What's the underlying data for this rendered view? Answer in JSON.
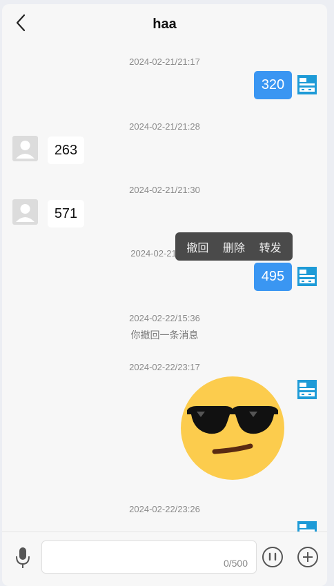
{
  "header": {
    "title": "haa"
  },
  "messages": [
    {
      "time": "2024-02-21/21:17",
      "from": "me",
      "text": "320"
    },
    {
      "time": "2024-02-21/21:28",
      "from": "other",
      "text": "263"
    },
    {
      "time": "2024-02-21/21:30",
      "from": "other",
      "text": "571"
    },
    {
      "time": "2024-02-21",
      "from": "me",
      "text": "495"
    },
    {
      "time": "2024-02-22/15:36",
      "notice": "你撤回一条消息"
    },
    {
      "time": "2024-02-22/23:17",
      "from": "me",
      "sticker": "sunglasses-emoji"
    },
    {
      "time": "2024-02-22/23:26",
      "from": "me"
    }
  ],
  "context_menu": {
    "recall": "撤回",
    "delete": "删除",
    "forward": "转发"
  },
  "input": {
    "counter": "0/500"
  },
  "icons": {
    "back": "chevron-left-icon",
    "mic": "microphone-icon",
    "emoji": "emoji-face-icon",
    "plus": "plus-circle-icon",
    "avatar_me": "pixel-avatar-icon",
    "avatar_other": "default-user-icon"
  },
  "colors": {
    "my_bubble": "#3a96f2",
    "my_avatar": "#1e9bd7",
    "menu_bg": "#4a4a4a"
  }
}
